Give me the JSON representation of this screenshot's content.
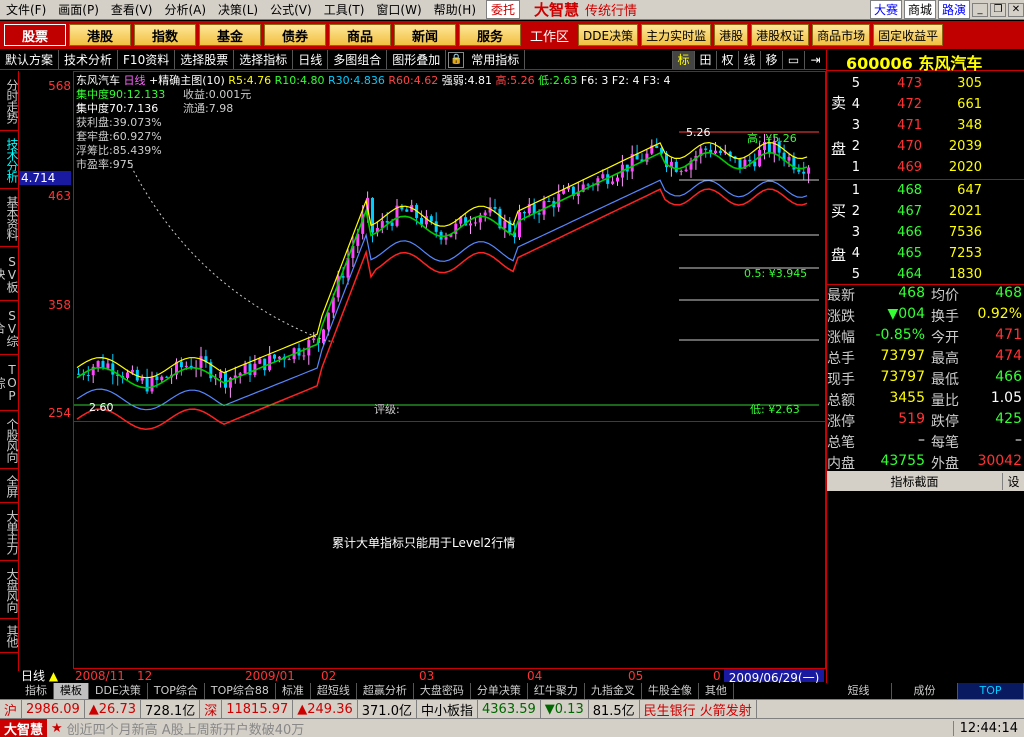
{
  "menu": {
    "items": [
      "文件(F)",
      "画面(P)",
      "查看(V)",
      "分析(A)",
      "决策(L)",
      "公式(V)",
      "工具(T)",
      "窗口(W)",
      "帮助(H)"
    ],
    "trust": "委托",
    "brand": "大智慧",
    "brand_sub": "传统行情",
    "right": [
      "大赛",
      "商城",
      "路演"
    ]
  },
  "toolbar": {
    "tabs": [
      "股票",
      "港股",
      "指数",
      "基金",
      "债券",
      "商品",
      "新闻",
      "服务"
    ],
    "workspace": "工作区",
    "right": [
      "DDE决策",
      "主力实时监",
      "港股",
      "港股权证",
      "商品市场",
      "固定收益平"
    ]
  },
  "subbar": {
    "items": [
      "默认方案",
      "技术分析",
      "F10资料",
      "选择股票",
      "选择指标",
      "日线",
      "多图组合",
      "图形叠加",
      "常用指标"
    ],
    "icons": [
      "标",
      "田",
      "权",
      "线",
      "移"
    ]
  },
  "vtabs": [
    "分时走势",
    "技术分析",
    "基本资料",
    "SV板块",
    "SV综合",
    "TOP综",
    "个股风向",
    "全屏",
    "大单主力",
    "大盘风向",
    "其他"
  ],
  "chart": {
    "header": {
      "name": "东风汽车",
      "period": "日线",
      "main": "+精确主图(10)",
      "ma": [
        {
          "k": "R5:",
          "v": "4.76"
        },
        {
          "k": "R10:",
          "v": "4.80"
        },
        {
          "k": "R30:",
          "v": "4.836"
        },
        {
          "k": "R60:",
          "v": "4.62"
        }
      ],
      "strength": "强弱:",
      "strength_v": "4.81",
      "hi_lbl": "高:",
      "hi_v": "5.26",
      "lo_lbl": "低:",
      "lo_v": "2.63",
      "f6": "F6: 3",
      "f2": "F2: 4",
      "f3": "F3: 4"
    },
    "stats": [
      {
        "k": "集中度90:",
        "v": "12.133"
      },
      {
        "k": "集中度70:",
        "v": "7.136"
      },
      {
        "k": "获利盘:",
        "v": "39.073%"
      },
      {
        "k": "套牢盘:",
        "v": "60.927%"
      },
      {
        "k": "浮筹比:",
        "v": "85.439%"
      },
      {
        "k": "市盈率:",
        "v": "975"
      }
    ],
    "returns": [
      {
        "k": "收益:",
        "v": "0.001元"
      },
      {
        "k": "流通:",
        "v": "7.98"
      }
    ],
    "price_ticks": [
      "568",
      "463",
      "358",
      "254"
    ],
    "current": "4.714",
    "hi_label": "高: ¥5.26",
    "lo_label": "低: ¥2.63",
    "mid_label": "0.5: ¥3.945",
    "top_tag": "5.26",
    "bot_tag": "2.60",
    "rating": "评级:",
    "sub_message": "累计大单指标只能用于Level2行情",
    "dates": [
      "2008/11",
      "12",
      "2009/01",
      "02",
      "03",
      "04",
      "05",
      "0"
    ],
    "day_label": "日线",
    "current_date": "2009/06/29(一)"
  },
  "bottom_tabs": [
    "指标",
    "模板",
    "DDE决策",
    "TOP综合",
    "TOP综合88",
    "标准",
    "超短线",
    "超赢分析",
    "大盘密码",
    "分单决策",
    "红牛聚力",
    "九指金叉",
    "牛股全像",
    "其他"
  ],
  "right_tabs": [
    "短线",
    "成份",
    "TOP"
  ],
  "stock": {
    "code": "600006",
    "name": "东风汽车"
  },
  "orderbook": {
    "sell_label": "卖盘",
    "buy_label": "买盘",
    "sell": [
      {
        "lv": "5",
        "p": "473",
        "v": "305"
      },
      {
        "lv": "4",
        "p": "472",
        "v": "661"
      },
      {
        "lv": "3",
        "p": "471",
        "v": "348"
      },
      {
        "lv": "2",
        "p": "470",
        "v": "2039"
      },
      {
        "lv": "1",
        "p": "469",
        "v": "2020"
      }
    ],
    "buy": [
      {
        "lv": "1",
        "p": "468",
        "v": "647"
      },
      {
        "lv": "2",
        "p": "467",
        "v": "2021"
      },
      {
        "lv": "3",
        "p": "466",
        "v": "7536"
      },
      {
        "lv": "4",
        "p": "465",
        "v": "7253"
      },
      {
        "lv": "5",
        "p": "464",
        "v": "1830"
      }
    ]
  },
  "quote": [
    {
      "k": "最新",
      "v": "468",
      "vc": "grn",
      "k2": "均价",
      "v2": "468",
      "v2c": "grn"
    },
    {
      "k": "涨跌",
      "v": "▼004",
      "vc": "grn",
      "k2": "换手",
      "v2": "0.92%",
      "v2c": "yel"
    },
    {
      "k": "涨幅",
      "v": "-0.85%",
      "vc": "grn",
      "k2": "今开",
      "v2": "471",
      "v2c": "red"
    },
    {
      "k": "总手",
      "v": "73797",
      "vc": "yel",
      "k2": "最高",
      "v2": "474",
      "v2c": "red"
    },
    {
      "k": "现手",
      "v": "73797",
      "vc": "yel",
      "k2": "最低",
      "v2": "466",
      "v2c": "grn"
    },
    {
      "k": "总额",
      "v": "3455",
      "vc": "yel",
      "k2": "量比",
      "v2": "1.05",
      "v2c": "wht"
    },
    {
      "k": "涨停",
      "v": "519",
      "vc": "red",
      "k2": "跌停",
      "v2": "425",
      "v2c": "grn"
    },
    {
      "k": "总笔",
      "v": "–",
      "vc": "wht",
      "k2": "每笔",
      "v2": "–",
      "v2c": "wht"
    },
    {
      "k": "内盘",
      "v": "43755",
      "vc": "grn",
      "k2": "外盘",
      "v2": "30042",
      "v2c": "red"
    }
  ],
  "panel": {
    "title": "指标截面",
    "btn": "设"
  },
  "status1": [
    {
      "t": "沪",
      "c": "#c00"
    },
    {
      "t": "2986.09",
      "c": "#c00"
    },
    {
      "t": "▲26.73",
      "c": "#c00"
    },
    {
      "t": "728.1亿",
      "c": "#000"
    },
    {
      "t": "深",
      "c": "#c00"
    },
    {
      "t": "11815.97",
      "c": "#c00"
    },
    {
      "t": "▲249.36",
      "c": "#c00"
    },
    {
      "t": "371.0亿",
      "c": "#000"
    },
    {
      "t": "中小板指",
      "c": "#000"
    },
    {
      "t": "4363.59",
      "c": "#060"
    },
    {
      "t": "▼0.13",
      "c": "#060"
    },
    {
      "t": "81.5亿",
      "c": "#000"
    },
    {
      "t": "民生银行 火箭发射",
      "c": "#c00"
    }
  ],
  "status2": {
    "brand": "大智慧",
    "news": "创近四个月新高 A股上周新开户数破40万",
    "time": "12:44:14"
  }
}
